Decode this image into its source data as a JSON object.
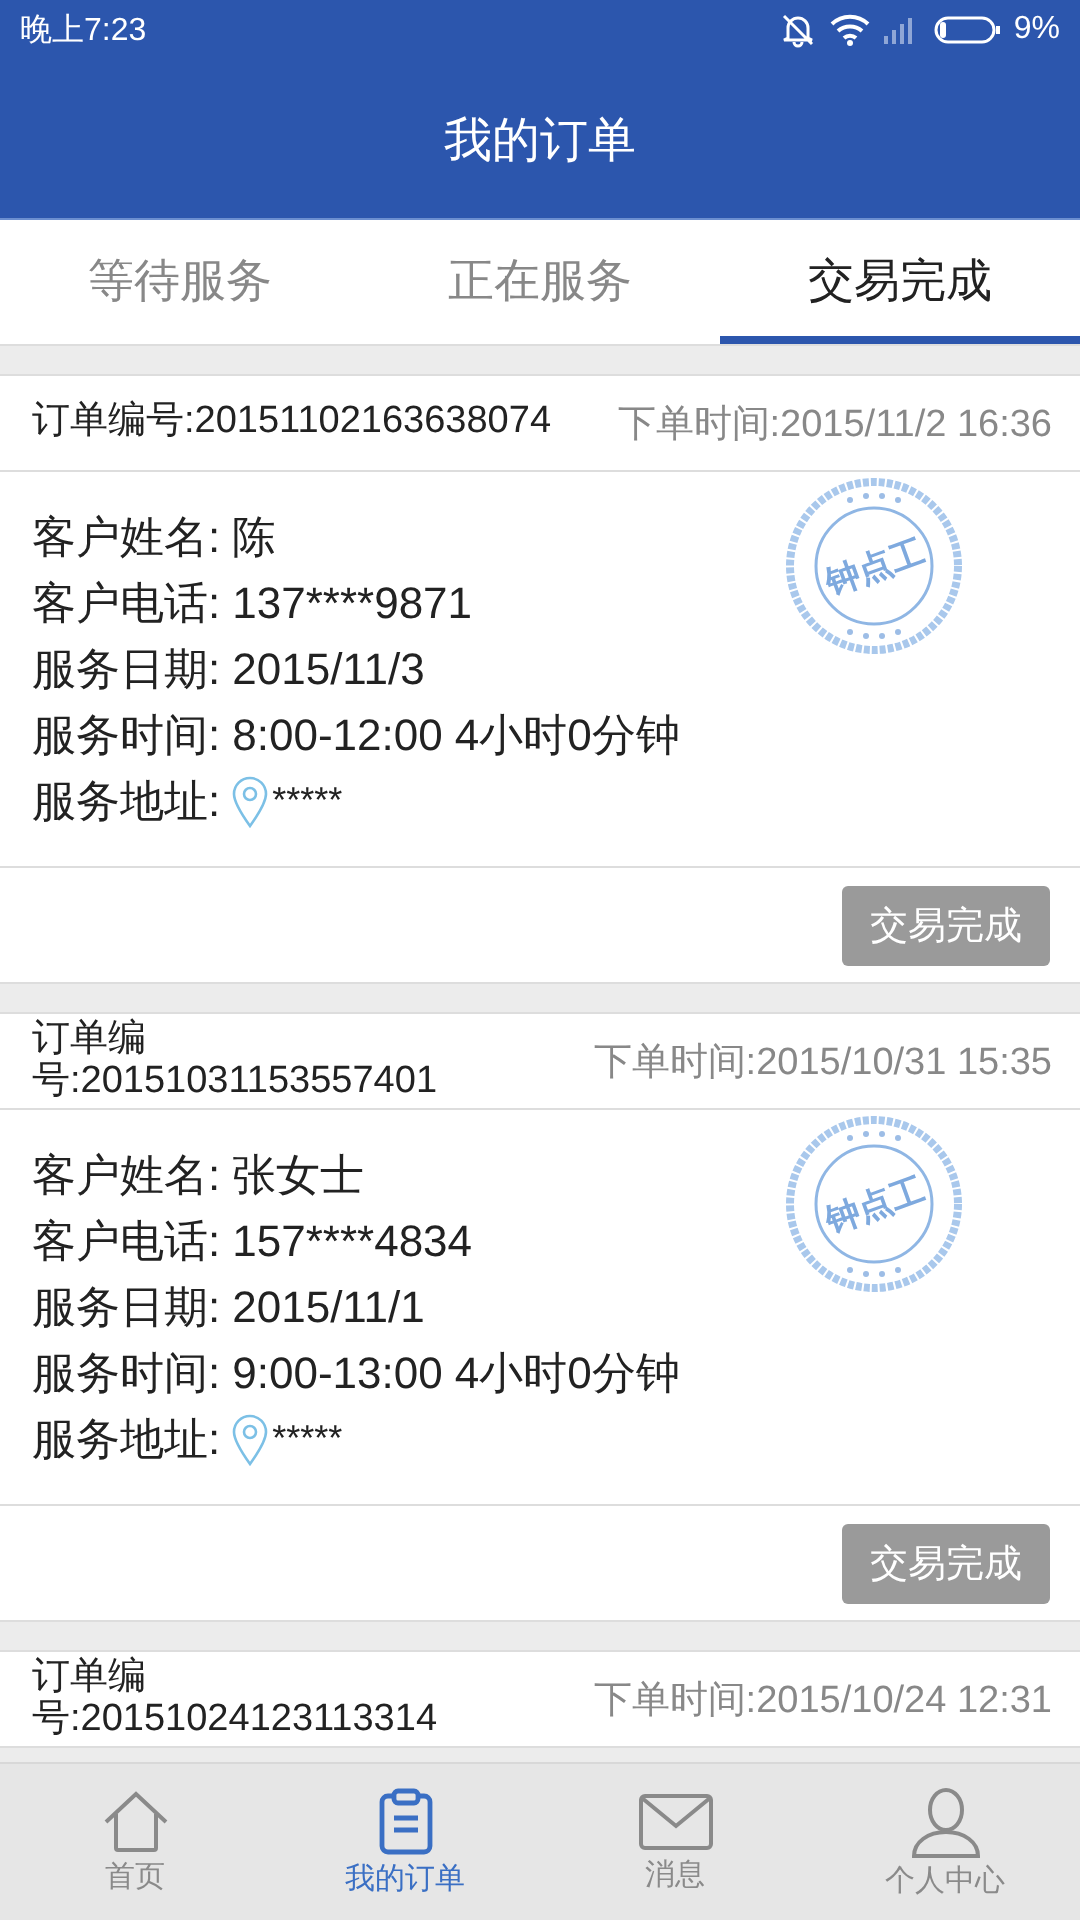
{
  "status_bar": {
    "time": "晚上7:23",
    "battery": "9%"
  },
  "header": {
    "title": "我的订单"
  },
  "tabs": [
    {
      "label": "等待服务",
      "selected": false
    },
    {
      "label": "正在服务",
      "selected": false
    },
    {
      "label": "交易完成",
      "selected": true
    }
  ],
  "orders": [
    {
      "order_no": "订单编号:20151102163638074",
      "order_time": "下单时间:2015/11/2 16:36",
      "stamp": "钟点工",
      "fields": [
        {
          "label": "客户姓名:",
          "value": "陈"
        },
        {
          "label": "客户电话:",
          "value": "137****9871"
        },
        {
          "label": "服务日期:",
          "value": "2015/11/3"
        },
        {
          "label": "服务时间:",
          "value": "8:00-12:00  4小时0分钟"
        },
        {
          "label": "服务地址:",
          "value": "*****",
          "kind": "address"
        }
      ],
      "button": "交易完成"
    },
    {
      "order_no": "订单编号:20151031153557401",
      "order_time": "下单时间:2015/10/31 15:35",
      "stamp": "钟点工",
      "fields": [
        {
          "label": "客户姓名:",
          "value": "张女士"
        },
        {
          "label": "客户电话:",
          "value": "157****4834"
        },
        {
          "label": "服务日期:",
          "value": "2015/11/1"
        },
        {
          "label": "服务时间:",
          "value": "9:00-13:00  4小时0分钟"
        },
        {
          "label": "服务地址:",
          "value": "*****",
          "kind": "address"
        }
      ],
      "button": "交易完成"
    },
    {
      "order_no": "订单编号:20151024123113314",
      "order_time": "下单时间:2015/10/24 12:31"
    }
  ],
  "nav": [
    {
      "label": "首页",
      "kind": "home",
      "selected": false
    },
    {
      "label": "我的订单",
      "kind": "clipboard",
      "selected": true
    },
    {
      "label": "消息",
      "kind": "mail",
      "selected": false
    },
    {
      "label": "个人中心",
      "kind": "person",
      "selected": false
    }
  ]
}
